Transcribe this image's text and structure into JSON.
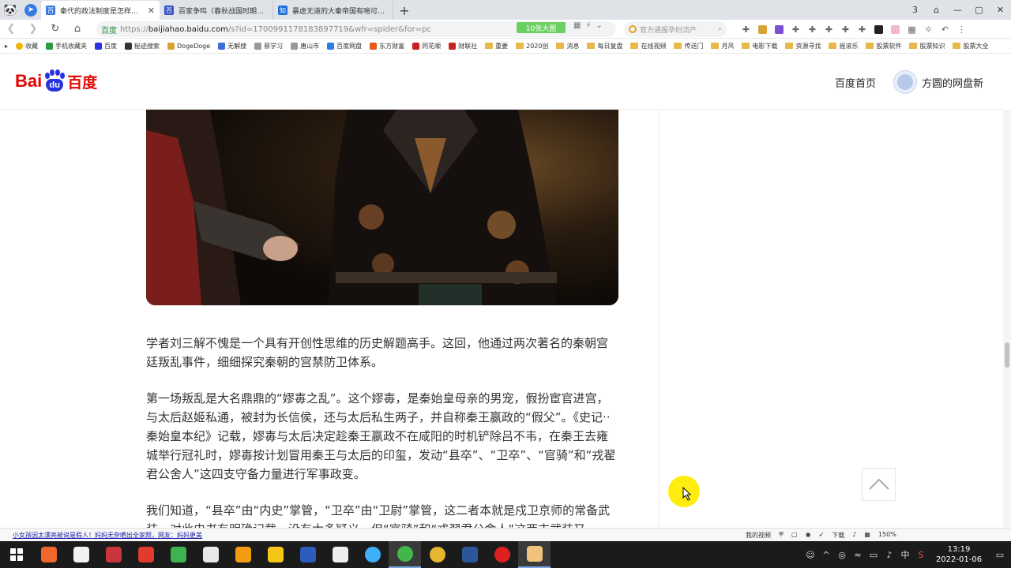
{
  "browser": {
    "tabs": [
      {
        "title": "秦代的政法制度是怎样的呢？为什么说是“一族连坐”",
        "active": true,
        "favicon_color": "#3a7be0"
      },
      {
        "title": "百家争鸣（春秋战国时期历史局面）",
        "active": false,
        "favicon_color": "#3653c7"
      },
      {
        "title": "暴虐无道的大秦帝国有啥可炫耀的？",
        "active": false,
        "favicon_color": "#1e6fd9"
      }
    ],
    "window_controls": [
      "3",
      "⌂",
      "—",
      "▢",
      "✕"
    ],
    "url": {
      "site_label": "百度",
      "scheme": "https://",
      "host": "baijiahao.baidu.com",
      "path": "/s?id=1700991178183897719&wfr=spider&for=pc"
    },
    "zoom_tag": "10张大图",
    "search_placeholder": "官方通报孕妇流产",
    "bookmarks": [
      {
        "label": "收藏",
        "type": "star"
      },
      {
        "label": "手机收藏夹",
        "type": "icon",
        "color": "#2f9b3e"
      },
      {
        "label": "百度",
        "type": "icon",
        "color": "#2932e1"
      },
      {
        "label": "秘迹搜索",
        "type": "icon",
        "color": "#333333"
      },
      {
        "label": "DogeDoge",
        "type": "icon",
        "color": "#d9a237"
      },
      {
        "label": "无解搜",
        "type": "icon",
        "color": "#3b6fd8"
      },
      {
        "label": "蔡学习",
        "type": "icon",
        "color": "#999999"
      },
      {
        "label": "唐山市",
        "type": "icon",
        "color": "#999999"
      },
      {
        "label": "百度网盘",
        "type": "icon",
        "color": "#2f7be6"
      },
      {
        "label": "东方财富",
        "type": "icon",
        "color": "#e85a1a"
      },
      {
        "label": "同花顺",
        "type": "icon",
        "color": "#c81e1e"
      },
      {
        "label": "财联社",
        "type": "icon",
        "color": "#c81e1e"
      },
      {
        "label": "重要",
        "type": "folder"
      },
      {
        "label": "2020创",
        "type": "folder"
      },
      {
        "label": "消息",
        "type": "folder"
      },
      {
        "label": "每日复盘",
        "type": "folder"
      },
      {
        "label": "在线视频",
        "type": "folder"
      },
      {
        "label": "传送门",
        "type": "folder"
      },
      {
        "label": "月风",
        "type": "folder"
      },
      {
        "label": "电影下载",
        "type": "folder"
      },
      {
        "label": "资源寻找",
        "type": "folder"
      },
      {
        "label": "摇滚乐",
        "type": "folder"
      },
      {
        "label": "股票软件",
        "type": "folder"
      },
      {
        "label": "股票知识",
        "type": "folder"
      },
      {
        "label": "股票大全",
        "type": "folder"
      }
    ]
  },
  "page": {
    "logo_text_bai": "Bai",
    "logo_text_du": "du",
    "logo_text_cn": "百度",
    "home_link": "百度首页",
    "username": "方圆的网盘新"
  },
  "article": {
    "paragraphs": [
      "学者刘三解不愧是一个具有开创性思维的历史解题高手。这回，他通过两次著名的秦朝宫廷叛乱事件，细细探究秦朝的宫禁防卫体系。",
      "第一场叛乱是大名鼎鼎的“嫪毐之乱”。这个嫪毐，是秦始皇母亲的男宠，假扮宦官进宫，与太后赵姬私通，被封为长信侯，还与太后私生两子，并自称秦王嬴政的“假父”。《史记··秦始皇本纪》记载，嫪毐与太后决定趁秦王嬴政不在咸阳的时机铲除吕不韦，在秦王去雍城举行冠礼时，嫪毐按计划冒用秦王与太后的印玺，发动“县卒”、“卫卒”、“官骑”和“戎翟君公舍人”这四支守备力量进行军事政变。",
      "我们知道，“县卒”由“内史”掌管，“卫卒”由“卫尉”掌管，这二者本就是戍卫京师的常备武装，对此史书有明确记载，没有太多疑义。但“官骑”和“戎翟君公舍人”这两支武装又"
    ]
  },
  "statusbar": {
    "news": "小女孩因太漂亮被说是假人！妈妈无奈晒出全家照，网友：妈妈更美",
    "right_items": [
      "我的视频",
      "下载",
      "150%"
    ]
  },
  "taskbar": {
    "apps": [
      {
        "name": "start",
        "color": "#ffffff"
      },
      {
        "name": "app-orange",
        "color": "#f0672b"
      },
      {
        "name": "app-penguin",
        "color": "#f2f2f2"
      },
      {
        "name": "app-red-mask",
        "color": "#c8353b"
      },
      {
        "name": "app-browser-red",
        "color": "#e23b2e"
      },
      {
        "name": "app-clover",
        "color": "#3fb34f"
      },
      {
        "name": "app-calculator",
        "color": "#e8e8e8"
      },
      {
        "name": "app-search",
        "color": "#f39c12"
      },
      {
        "name": "app-grid",
        "color": "#f5c518"
      },
      {
        "name": "app-pen",
        "color": "#2c5dbd"
      },
      {
        "name": "app-x",
        "color": "#eeeeee"
      },
      {
        "name": "app-q",
        "color": "#3db0f7"
      },
      {
        "name": "app-360-browser",
        "color": "#43b649",
        "active": true
      },
      {
        "name": "app-chrome",
        "color": "#e8b530"
      },
      {
        "name": "app-word",
        "color": "#2b579a"
      },
      {
        "name": "app-record",
        "color": "#e02020"
      },
      {
        "name": "app-avatar",
        "color": "#f0c27b",
        "active": true
      }
    ],
    "ime": "中",
    "time": "13:19",
    "date": "2022-01-06"
  }
}
